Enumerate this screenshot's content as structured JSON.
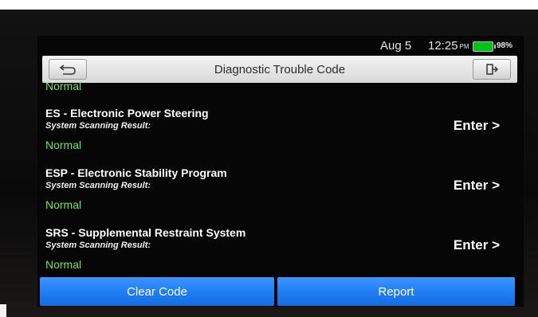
{
  "status_bar": {
    "date": "Aug 5",
    "time": "12:25",
    "ampm": "PM",
    "battery": "98%",
    "battery_level_percent": 98
  },
  "header": {
    "title": "Diagnostic Trouble Code",
    "back_icon": "back-arrow-icon",
    "exit_icon": "exit-icon"
  },
  "list": {
    "top_status": "Normal",
    "items": [
      {
        "title": "ES - Electronic Power Steering",
        "subtitle": "System Scanning Result:",
        "status": "Normal",
        "action": "Enter >"
      },
      {
        "title": "ESP - Electronic Stability Program",
        "subtitle": "System Scanning Result:",
        "status": "Normal",
        "action": "Enter >"
      },
      {
        "title": "SRS - Supplemental Restraint System",
        "subtitle": "System Scanning Result:",
        "status": "Normal",
        "action": "Enter >"
      }
    ]
  },
  "buttons": {
    "clear": "Clear Code",
    "report": "Report"
  },
  "colors": {
    "accent": "#1f7cf3",
    "status_normal": "#75e06a",
    "battery": "#00c21a"
  }
}
